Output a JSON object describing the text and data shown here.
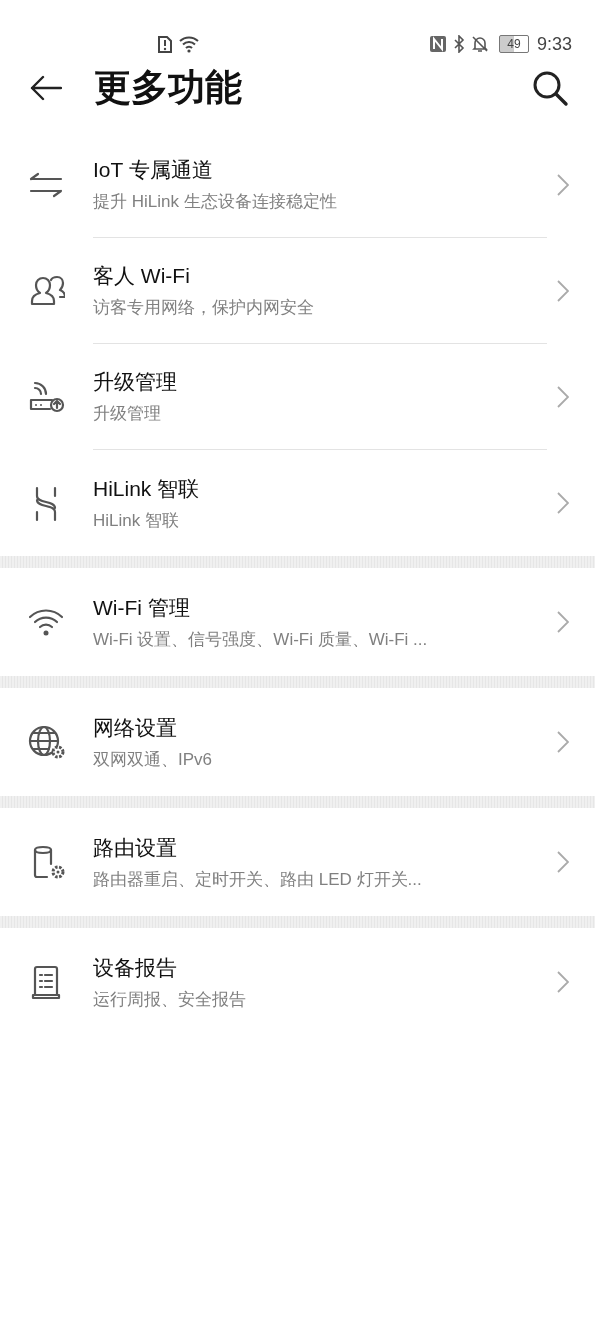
{
  "status_bar": {
    "battery": "49",
    "time": "9:33"
  },
  "header": {
    "title": "更多功能"
  },
  "groups": [
    {
      "items": [
        {
          "title": "IoT 专属通道",
          "subtitle": "提升 HiLink 生态设备连接稳定性"
        },
        {
          "title": "客人 Wi-Fi",
          "subtitle": "访客专用网络，保护内网安全"
        },
        {
          "title": "升级管理",
          "subtitle": "升级管理"
        },
        {
          "title": "HiLink 智联",
          "subtitle": "HiLink 智联"
        }
      ]
    },
    {
      "items": [
        {
          "title": "Wi-Fi 管理",
          "subtitle": "Wi-Fi 设置、信号强度、Wi-Fi 质量、Wi-Fi ..."
        }
      ]
    },
    {
      "items": [
        {
          "title": "网络设置",
          "subtitle": "双网双通、IPv6"
        }
      ]
    },
    {
      "items": [
        {
          "title": "路由设置",
          "subtitle": "路由器重启、定时开关、路由 LED 灯开关..."
        }
      ]
    },
    {
      "items": [
        {
          "title": "设备报告",
          "subtitle": "运行周报、安全报告"
        }
      ]
    }
  ]
}
